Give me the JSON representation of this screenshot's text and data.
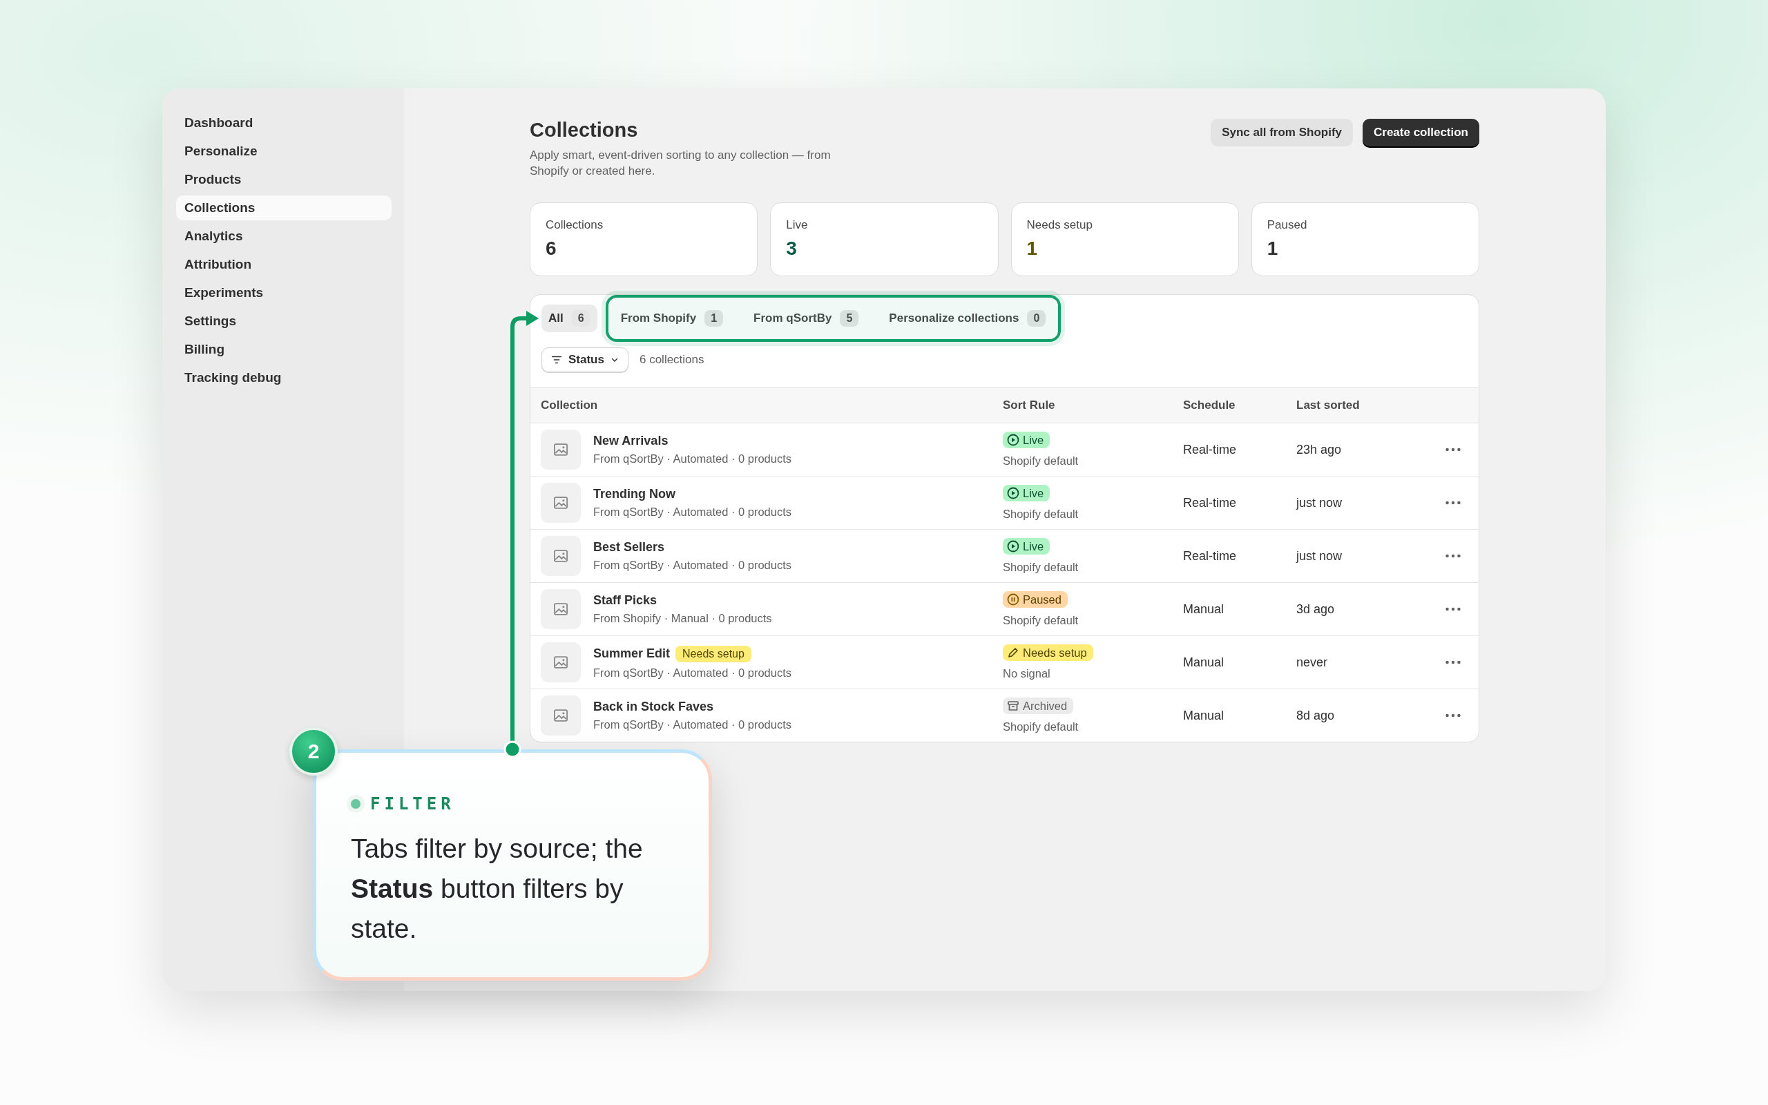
{
  "sidebar": {
    "items": [
      {
        "label": "Dashboard",
        "selected": false
      },
      {
        "label": "Personalize",
        "selected": false
      },
      {
        "label": "Products",
        "selected": false
      },
      {
        "label": "Collections",
        "selected": true
      },
      {
        "label": "Analytics",
        "selected": false
      },
      {
        "label": "Attribution",
        "selected": false
      },
      {
        "label": "Experiments",
        "selected": false
      },
      {
        "label": "Settings",
        "selected": false
      },
      {
        "label": "Billing",
        "selected": false
      },
      {
        "label": "Tracking debug",
        "selected": false
      }
    ]
  },
  "header": {
    "title": "Collections",
    "subtitle": "Apply smart, event-driven sorting to any collection — from Shopify or created here.",
    "buttons": [
      {
        "label": "Sync all from Shopify",
        "kind": "secondary"
      },
      {
        "label": "Create collection",
        "kind": "primary"
      }
    ]
  },
  "stats": [
    {
      "label": "Collections",
      "value": "6",
      "color": "#303030"
    },
    {
      "label": "Live",
      "value": "3",
      "color": "#0d5a47"
    },
    {
      "label": "Needs setup",
      "value": "1",
      "color": "#5e5700"
    },
    {
      "label": "Paused",
      "value": "1",
      "color": "#303030"
    }
  ],
  "tabs": [
    {
      "label": "All",
      "count": "6",
      "selected": true,
      "highlighted": false
    },
    {
      "label": "From Shopify",
      "count": "1",
      "selected": false,
      "highlighted": true
    },
    {
      "label": "From qSortBy",
      "count": "5",
      "selected": false,
      "highlighted": true
    },
    {
      "label": "Personalize collections",
      "count": "0",
      "selected": false,
      "highlighted": true
    }
  ],
  "filter": {
    "button": "Status",
    "count_text": "6 collections"
  },
  "table": {
    "columns": [
      "Collection",
      "Sort Rule",
      "Schedule",
      "Last sorted"
    ],
    "rows": [
      {
        "name": "New Arrivals",
        "meta": "From qSortBy · Automated · 0 products",
        "status": {
          "kind": "live",
          "label": "Live"
        },
        "rule": "Shopify default",
        "schedule": "Real-time",
        "last_sorted": "23h ago"
      },
      {
        "name": "Trending Now",
        "meta": "From qSortBy · Automated · 0 products",
        "status": {
          "kind": "live",
          "label": "Live"
        },
        "rule": "Shopify default",
        "schedule": "Real-time",
        "last_sorted": "just now"
      },
      {
        "name": "Best Sellers",
        "meta": "From qSortBy · Automated · 0 products",
        "status": {
          "kind": "live",
          "label": "Live"
        },
        "rule": "Shopify default",
        "schedule": "Real-time",
        "last_sorted": "just now"
      },
      {
        "name": "Staff Picks",
        "meta": "From Shopify · Manual · 0 products",
        "status": {
          "kind": "paused",
          "label": "Paused"
        },
        "rule": "Shopify default",
        "schedule": "Manual",
        "last_sorted": "3d ago"
      },
      {
        "name": "Summer Edit",
        "badge": "Needs setup",
        "meta": "From qSortBy · Automated · 0 products",
        "status": {
          "kind": "needs_setup",
          "label": "Needs setup"
        },
        "rule": "No signal",
        "schedule": "Manual",
        "last_sorted": "never"
      },
      {
        "name": "Back in Stock Faves",
        "meta": "From qSortBy · Automated · 0 products",
        "status": {
          "kind": "archived",
          "label": "Archived"
        },
        "rule": "Shopify default",
        "schedule": "Manual",
        "last_sorted": "8d ago"
      }
    ]
  },
  "callout": {
    "step": "2",
    "tag": "FILTER",
    "text": "Tabs filter by source; the **Status** button filters by state."
  }
}
